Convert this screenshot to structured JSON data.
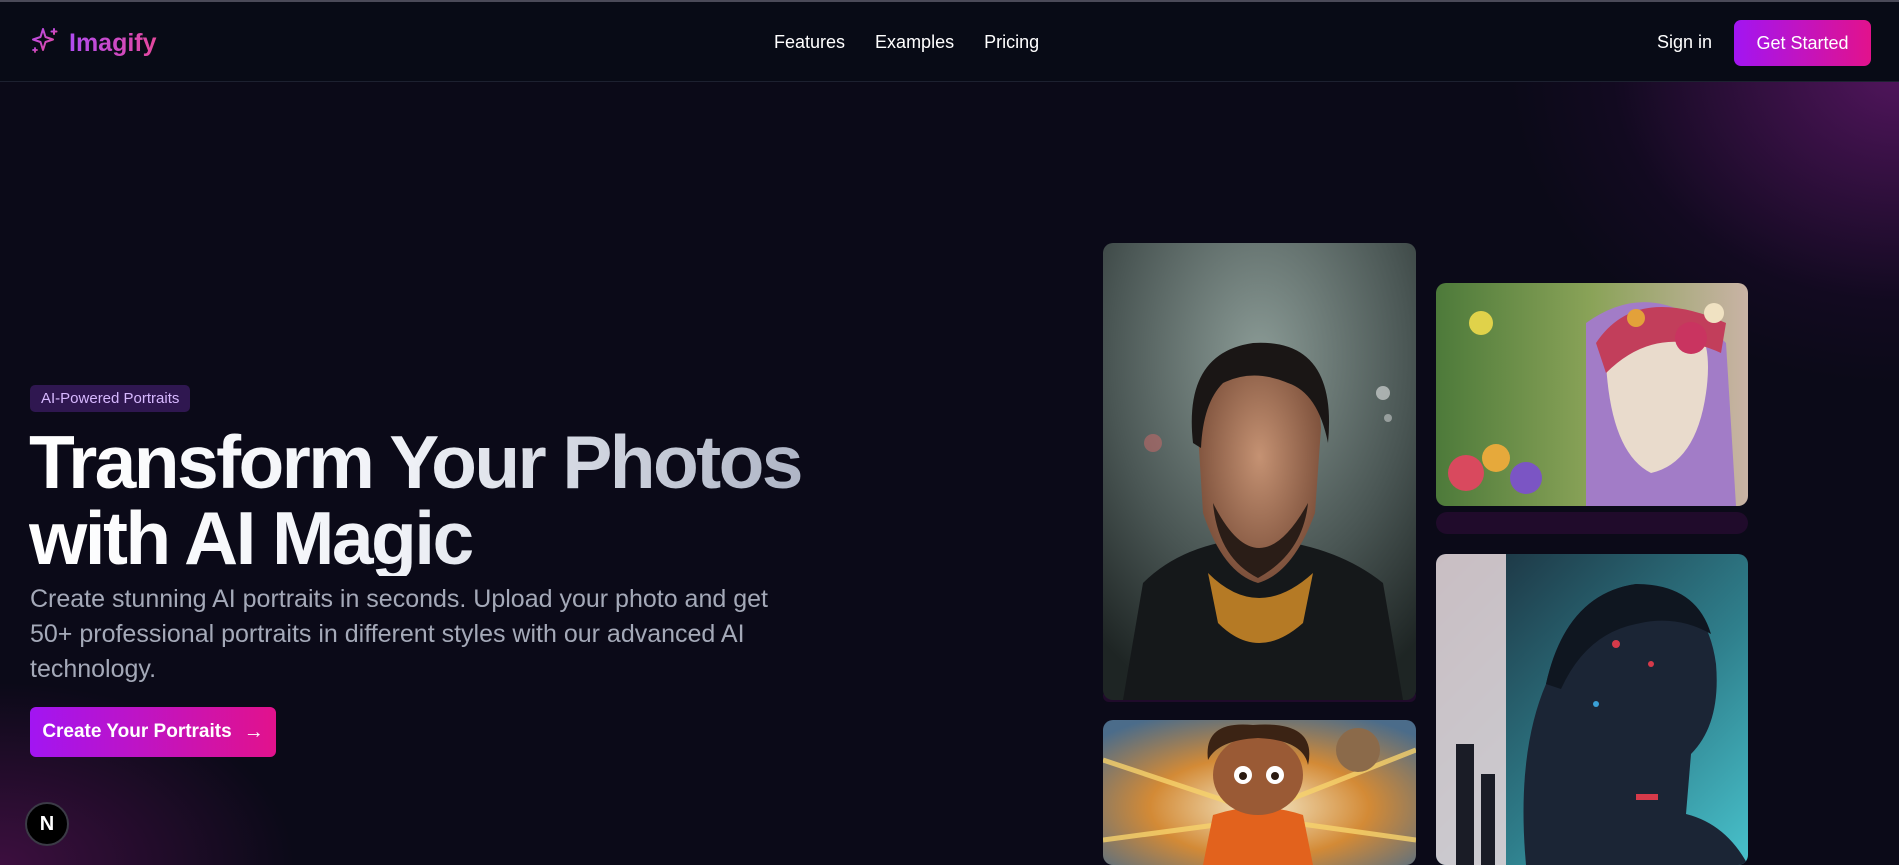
{
  "brand": {
    "name": "Imagify",
    "icon": "sparkle-icon",
    "accent_from": "#a215f2",
    "accent_to": "#e2128c"
  },
  "nav": {
    "items": [
      {
        "label": "Features"
      },
      {
        "label": "Examples"
      },
      {
        "label": "Pricing"
      }
    ]
  },
  "header": {
    "signin_label": "Sign in",
    "get_started_label": "Get Started"
  },
  "hero": {
    "badge": "AI-Powered Portraits",
    "title_line1": "Transform Your Photos",
    "title_line2": "with AI Magic",
    "subtitle": "Create stunning AI portraits in seconds. Upload your photo and get 50+ professional portraits in different styles with our advanced AI technology.",
    "cta_label": "Create Your Portraits",
    "cta_icon": "arrow-right-icon"
  },
  "gallery": [
    {
      "name": "portrait-man-winter-coat"
    },
    {
      "name": "portrait-yarn-doll-flowers"
    },
    {
      "name": "portrait-cartoon-kid-superhero"
    },
    {
      "name": "portrait-cyber-man-city"
    }
  ],
  "floating_badge": {
    "label": "N"
  }
}
